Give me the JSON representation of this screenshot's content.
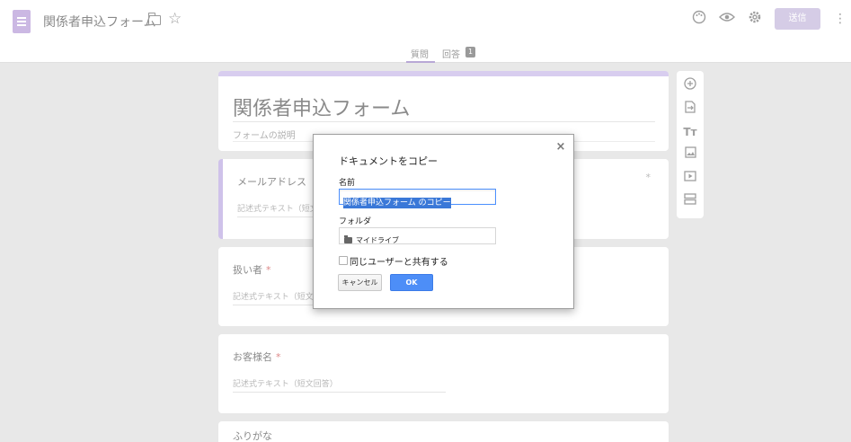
{
  "header": {
    "form_title": "関係者申込フォーム",
    "send_label": "送信",
    "tabs": [
      {
        "label": "質問"
      },
      {
        "label": "回答",
        "badge": "1"
      }
    ]
  },
  "form": {
    "title": "関係者申込フォーム",
    "description_placeholder": "フォームの説明",
    "questions": [
      {
        "label": "メールアドレス",
        "hint": "記述式テキスト（短文回答）",
        "required_mark": "*"
      },
      {
        "label": "扱い者",
        "hint": "記述式テキスト（短文回答）",
        "required_mark": "*"
      },
      {
        "label": "お客様名",
        "hint": "記述式テキスト（短文回答）",
        "required_mark": "*"
      },
      {
        "label": "ふりがな"
      }
    ]
  },
  "dialog": {
    "title": "ドキュメントをコピー",
    "close_label": "×",
    "name_label": "名前",
    "name_value": "関係者申込フォーム のコピー",
    "folder_label": "フォルダ",
    "folder_value": "マイドライブ",
    "share_label": "同じユーザーと共有する",
    "share_checked": false,
    "cancel_label": "キャンセル",
    "ok_label": "OK"
  },
  "colors": {
    "accent": "#d8cdef",
    "ok_button": "#4d8ef7",
    "selection": "#3a78d8",
    "background": "#e8e8e8"
  }
}
